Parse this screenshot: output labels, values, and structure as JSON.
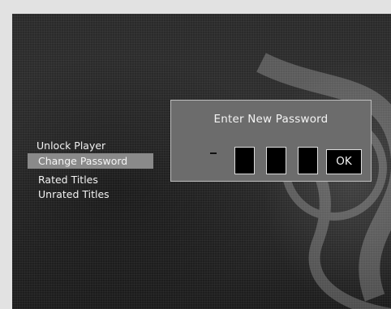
{
  "menu": {
    "items": [
      {
        "label": "Unlock Player"
      },
      {
        "label": "Change Password",
        "selected": true
      },
      {
        "label": "Rated Titles"
      },
      {
        "label": "Unrated Titles"
      }
    ]
  },
  "dialog": {
    "title": "Enter New Password",
    "dash": "-",
    "ok_label": "OK",
    "digit_count": 3
  },
  "colors": {
    "page_background": "#e2e2e2",
    "screen_background": "#2b2b2b",
    "dialog_background": "#6c6c6c",
    "dialog_border": "#bdbdbd",
    "selection_highlight": "#8a8a8a",
    "field_background": "#000000",
    "text": "#f4f4f4"
  },
  "icons": {
    "background_art": "decorative-dvd-artwork"
  }
}
